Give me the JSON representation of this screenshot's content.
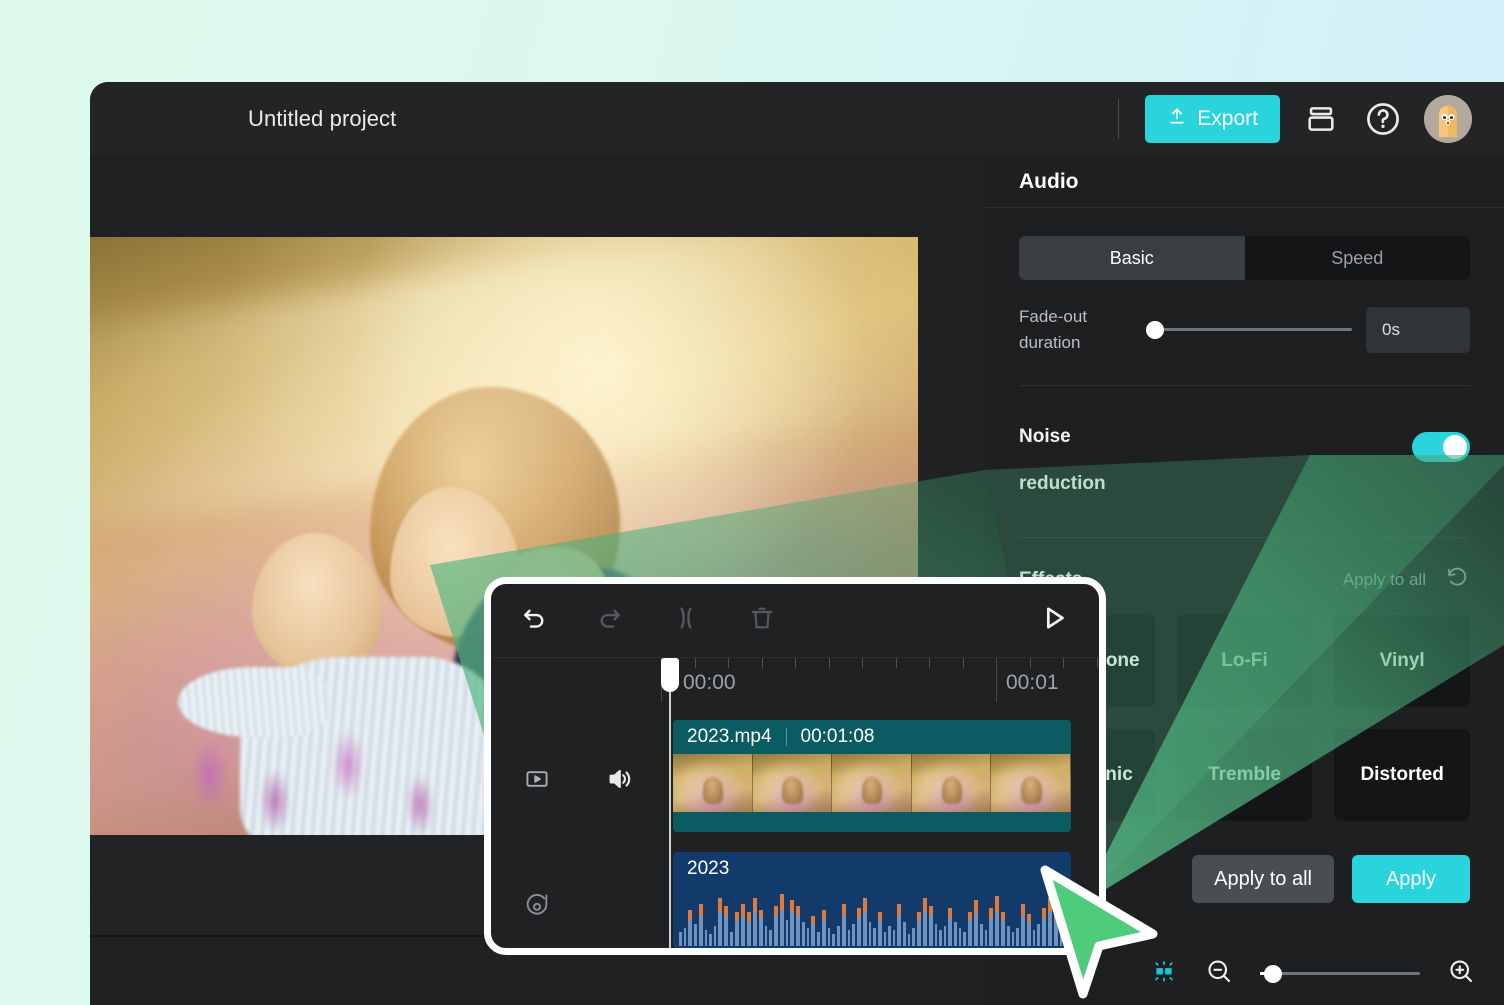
{
  "titlebar": {
    "project_title": "Untitled project",
    "export_label": "Export",
    "export_icon": "upload-icon",
    "layers_icon": "layers-icon",
    "help_icon": "help-circle-icon",
    "avatar_icon": "user-avatar",
    "accent_color": "#2ad4dd"
  },
  "preview": {
    "play_icon": "play-icon",
    "image_description": "Mother holding baby in sunlit wildflower meadow"
  },
  "panel": {
    "header": "Audio",
    "tabs": [
      {
        "label": "Basic",
        "active": true
      },
      {
        "label": "Speed",
        "active": false
      }
    ],
    "fade": {
      "label_line1": "Fade-out",
      "label_line2": "duration",
      "value": "0s",
      "slider_percent": 2
    },
    "noise": {
      "label_line1": "Noise",
      "label_line2": "reduction",
      "enabled": true,
      "toggle_color": "#2ad4dd"
    },
    "effects": {
      "title": "Effects",
      "apply_to_all_link": "Apply to all",
      "reset_icon": "reset-icon",
      "tiles": [
        {
          "label": "Megaphone"
        },
        {
          "label": "Lo-Fi"
        },
        {
          "label": "Vinyl"
        },
        {
          "label": "Electronic"
        },
        {
          "label": "Tremble"
        },
        {
          "label": "Distorted"
        }
      ]
    },
    "actions": {
      "apply_to_all": "Apply to all",
      "apply": "Apply"
    }
  },
  "zoombar": {
    "fit_icon": "fit-to-screen-icon",
    "zoom_out_icon": "zoom-out-icon",
    "zoom_in_icon": "zoom-in-icon",
    "zoom_percent": 8
  },
  "timeline": {
    "toolbar": [
      {
        "name": "undo-icon",
        "enabled": true
      },
      {
        "name": "redo-icon",
        "enabled": false
      },
      {
        "name": "split-icon",
        "enabled": false
      },
      {
        "name": "delete-icon",
        "enabled": false
      }
    ],
    "play_icon": "play-icon",
    "ruler": {
      "labels": [
        "00:00",
        "00:01"
      ]
    },
    "rail": {
      "video_track_icon": "video-track-icon",
      "volume_icon": "volume-icon",
      "music_track_icon": "music-note-icon"
    },
    "clips": [
      {
        "type": "video",
        "name": "2023.mp4",
        "duration": "00:01:08",
        "color": "#0b5b63"
      },
      {
        "type": "audio",
        "name": "2023",
        "color": "#123a6b"
      }
    ]
  },
  "cursor": {
    "icon": "pointer-cursor",
    "color": "#4ecb7b"
  }
}
